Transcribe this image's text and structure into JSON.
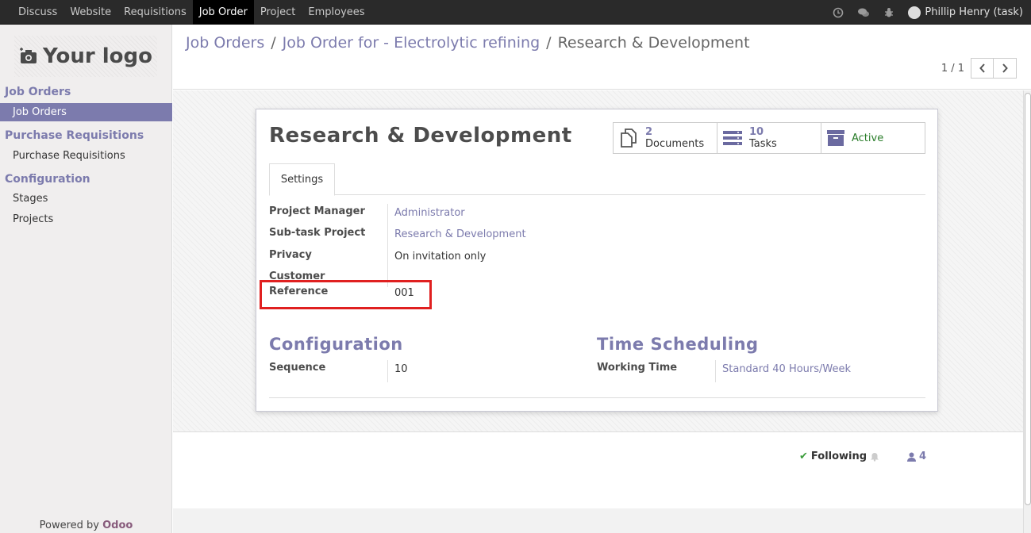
{
  "topbar": {
    "menu": [
      {
        "label": "Discuss"
      },
      {
        "label": "Website"
      },
      {
        "label": "Requisitions"
      },
      {
        "label": "Job Order"
      },
      {
        "label": "Project"
      },
      {
        "label": "Employees"
      }
    ],
    "active_menu": "Job Order",
    "user": "Phillip Henry (task)"
  },
  "sidebar": {
    "logo_text": "Your logo",
    "sections": [
      {
        "title": "Job Orders",
        "items": [
          "Job Orders"
        ]
      },
      {
        "title": "Purchase Requisitions",
        "items": [
          "Purchase Requisitions"
        ]
      },
      {
        "title": "Configuration",
        "items": [
          "Stages",
          "Projects"
        ]
      }
    ],
    "active_item": "Job Orders",
    "powered_by": "Powered by",
    "powered_brand": "Odoo"
  },
  "breadcrumb": {
    "items": [
      "Job Orders",
      "Job Order for - Electrolytic refining",
      "Research & Development"
    ],
    "separator": "/"
  },
  "pager": {
    "value": "1 / 1"
  },
  "form": {
    "title": "Research & Development",
    "smart_buttons": [
      {
        "count": "2",
        "label": "Documents",
        "icon": "documents-icon"
      },
      {
        "count": "10",
        "label": "Tasks",
        "icon": "tasks-icon"
      },
      {
        "count": "",
        "label": "Active",
        "icon": "archive-icon"
      }
    ],
    "tab": "Settings",
    "fields": {
      "project_manager_label": "Project Manager",
      "project_manager_value": "Administrator",
      "subtask_project_label": "Sub-task Project",
      "subtask_project_value": "Research & Development",
      "privacy_label": "Privacy",
      "privacy_value": "On invitation only",
      "customer_label": "Customer",
      "customer_value": "",
      "reference_label": "Reference",
      "reference_value": "001"
    },
    "configuration": {
      "title": "Configuration",
      "sequence_label": "Sequence",
      "sequence_value": "10"
    },
    "time_scheduling": {
      "title": "Time Scheduling",
      "working_time_label": "Working Time",
      "working_time_value": "Standard 40 Hours/Week"
    }
  },
  "chatter": {
    "following_label": "Following",
    "followers_count": "4"
  },
  "colors": {
    "accent": "#7c7bad",
    "highlight_box": "#e02020",
    "topbar": "#2a2a2a"
  }
}
